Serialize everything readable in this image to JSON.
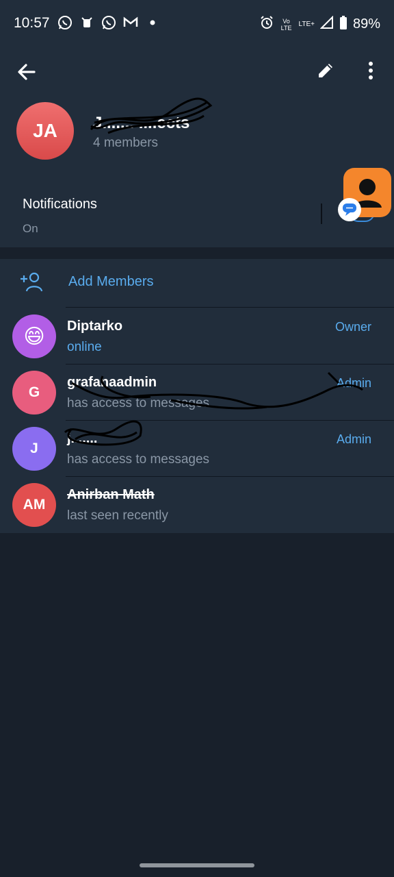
{
  "status_bar": {
    "time": "10:57",
    "left_icons": [
      "whatsapp-icon",
      "app-notification-icon",
      "whatsapp-icon",
      "gmail-icon",
      "dot-icon"
    ],
    "right_icons": [
      "alarm-icon",
      "volte-icon",
      "lte-plus-icon",
      "signal-icon",
      "battery-icon"
    ],
    "volte_label": "Vo LTE",
    "lte_label": "LTE+",
    "battery": "89%"
  },
  "header": {
    "avatar_initials": "JA",
    "title": "J....... ....ects",
    "subtitle": "4 members"
  },
  "notifications": {
    "title": "Notifications",
    "value": "On"
  },
  "add_members": {
    "label": "Add Members"
  },
  "members": [
    {
      "initials": "😄",
      "name": "Diptarko",
      "status": "online",
      "role": "Owner",
      "color": "#b25ee6"
    },
    {
      "initials": "G",
      "name": "grafanaadmin",
      "status": "has access to messages",
      "role": "Admin",
      "color": "#e85d7e"
    },
    {
      "initials": "J",
      "name": "j.......",
      "status": "has access to messages",
      "role": "Admin",
      "color": "#8a6df0"
    },
    {
      "initials": "AM",
      "name": "Anirban Math",
      "status": "last seen recently",
      "role": "",
      "color": "#e24f4f"
    }
  ],
  "colors": {
    "background": "#18202b",
    "surface": "#212d3b",
    "accent": "#5aacee",
    "overlay": "#f4862c"
  }
}
